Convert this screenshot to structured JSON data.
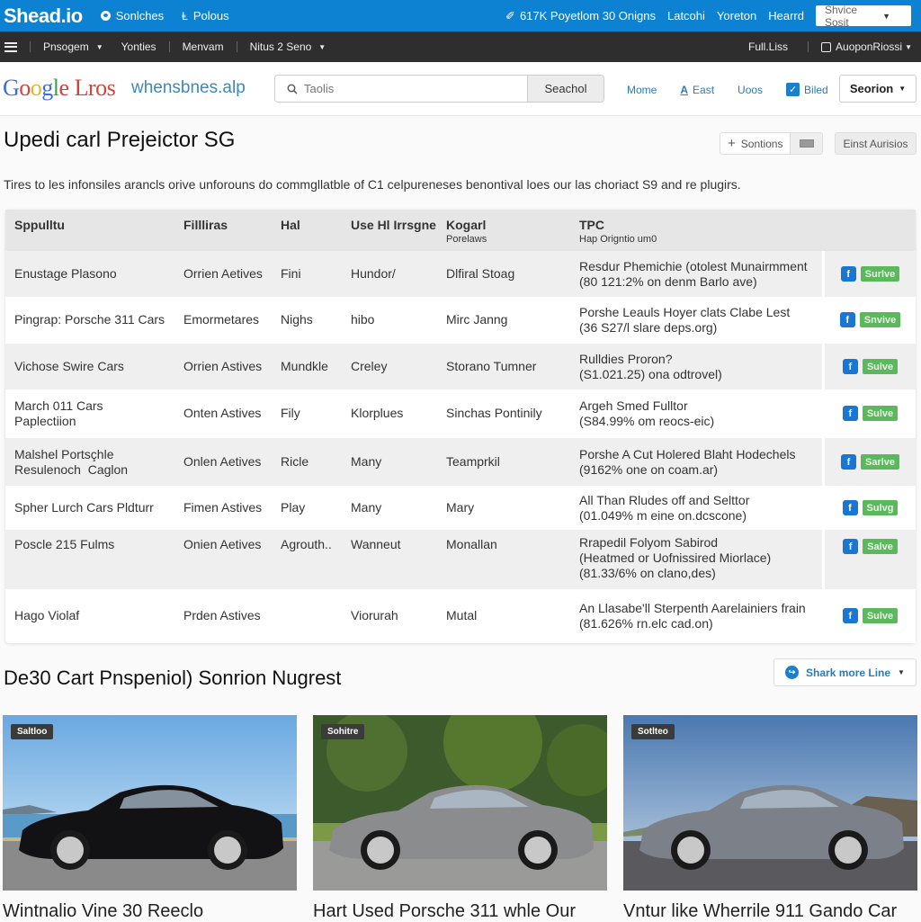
{
  "topbar": {
    "brand": "Shead.io",
    "links": [
      {
        "label": "Sonlches",
        "icon": "circle-icon"
      },
      {
        "label": "Polous",
        "icon": "user-icon"
      }
    ],
    "right_links": [
      "617K Poyetlom 30 Onigns",
      "Latcohi",
      "Yoreton",
      "Hearrd"
    ],
    "select_value": "Shvice Sosit"
  },
  "navbar": {
    "items": [
      {
        "label": "Pnsogem",
        "dropdown": true
      },
      {
        "label": "Yonties"
      },
      {
        "label": "Menvam"
      },
      {
        "label": "Nitus 2 Seno",
        "dropdown": true
      }
    ],
    "right": {
      "full_list": "Full.Liss",
      "account": "AuoponRiossi"
    }
  },
  "header": {
    "logo_parts": [
      {
        "t": "G",
        "c": "#3a6fd8"
      },
      {
        "t": "o",
        "c": "#d8403a"
      },
      {
        "t": "o",
        "c": "#e8b52a"
      },
      {
        "t": "g",
        "c": "#3a6fd8"
      },
      {
        "t": "l",
        "c": "#3aa04a"
      },
      {
        "t": "e",
        "c": "#d8403a"
      },
      {
        "t": " Lros",
        "c": "#d8403a"
      }
    ],
    "site": "whensbnes.alp",
    "search_placeholder": "Taolis",
    "search_button": "Seachol",
    "links": [
      "Mome",
      "East",
      "Uoos",
      "Biled"
    ],
    "section_select": "Seorion"
  },
  "page": {
    "title": "Upedi carl Prejeictor SG",
    "sections_button": "Sontions",
    "first_button": "Einst Aurisios",
    "description": "Tires to les infonsiles arancls orive unforouns do commgllatble of C1 celpureneses benontival loes our las choriact S9 and re plugirs."
  },
  "table": {
    "headers": [
      {
        "label": "Sppulltu"
      },
      {
        "label": "Fillliras"
      },
      {
        "label": "Hal"
      },
      {
        "label": "Use Hl Irrsgne"
      },
      {
        "label": "Kogarl",
        "sub": "Porelaws"
      },
      {
        "label": "TPC",
        "sub": "Hap Origntio um0"
      }
    ],
    "rows": [
      {
        "c": [
          "Enustage Plasono",
          "Orrien Aetives",
          "Fini",
          "Hundor/",
          "Dlfiral Stoag"
        ],
        "tpc": [
          "Resdur Phemichie (otolest Munairmment",
          "(80 121:2% on denm Barlo ave)"
        ],
        "save": "Surlve"
      },
      {
        "c": [
          "Pingrap: Porsche 311 Cars",
          "Emormetares",
          "Nighs",
          "hibo",
          "Mirc Janng"
        ],
        "tpc": [
          "Porshe Leauls Hoyer clats Clabe Lest",
          "(36 S27/l slare deps.org)"
        ],
        "save": "Snvive"
      },
      {
        "c": [
          "Vichose Swire Cars",
          "Orrien Astives",
          "Mundkle",
          "Creley",
          "Storano Tumner"
        ],
        "tpc": [
          "Rulldies Proron?",
          "(S1.021.25) ona odtrovel)"
        ],
        "save": "Sulve"
      },
      {
        "c": [
          "March 011 Cars\nPaplectiion",
          "Onten Astives",
          "Fily",
          "Klorplues",
          "Sinchas Pontinily"
        ],
        "tpc": [
          "Argeh Smed Fulltor",
          "(S84.99% om reocs-eic)"
        ],
        "save": "Sulve"
      },
      {
        "c": [
          "Malshel Portsçhle\nResulenoch  Caglon",
          "Onlen Aetives",
          "Ricle",
          "Many",
          "Teamprkil"
        ],
        "tpc": [
          "Porshe A Cut Holered Blaht Hodechels",
          "(9162% one on coam.ar)"
        ],
        "save": "Sarlve"
      },
      {
        "c": [
          "Spher Lurch Cars Pldturr",
          "Fimen Astives",
          "Play",
          "Many",
          "Mary"
        ],
        "tpc": [
          "All Than Rludes off and Selttor",
          "(01.049%  m eine on.dcscone)"
        ],
        "save": "Sulvg"
      },
      {
        "c": [
          "Poscle 215 Fulms",
          "Onien Aetives",
          "Agrouth..",
          "Wanneut",
          "Monallan"
        ],
        "tpc": [
          "Rrapedil Folyom Sabirod",
          "(Heatmed or Uofnissired Miorlace)",
          "(81.33/6% on clano,des)"
        ],
        "save": "Salve"
      },
      {
        "c": [
          "Hago Violaf",
          "Prden Astives",
          "",
          "Viorurah",
          "Mutal"
        ],
        "tpc": [
          "An Llasabe'll Sterpenth Aarelainiers frain",
          "(81.626% rn.elc cad.on)"
        ],
        "save": "Sulve"
      }
    ]
  },
  "gallery": {
    "title": "De30 Cart Pnspeniol) Sonrion Nugrest",
    "share_button": "Shark more Line",
    "cards": [
      {
        "tag": "Saltloo",
        "title": "Wintnalio Vine 30 Reeclo",
        "car_color": "#121214"
      },
      {
        "tag": "Sohitre",
        "title": "Hart Used Porsche 311 whle Our",
        "car_color": "#8a8c8e"
      },
      {
        "tag": "Sotlteo",
        "title": "Vntur like Wherrile 911 Gando Car",
        "car_color": "#7c8088"
      }
    ]
  }
}
